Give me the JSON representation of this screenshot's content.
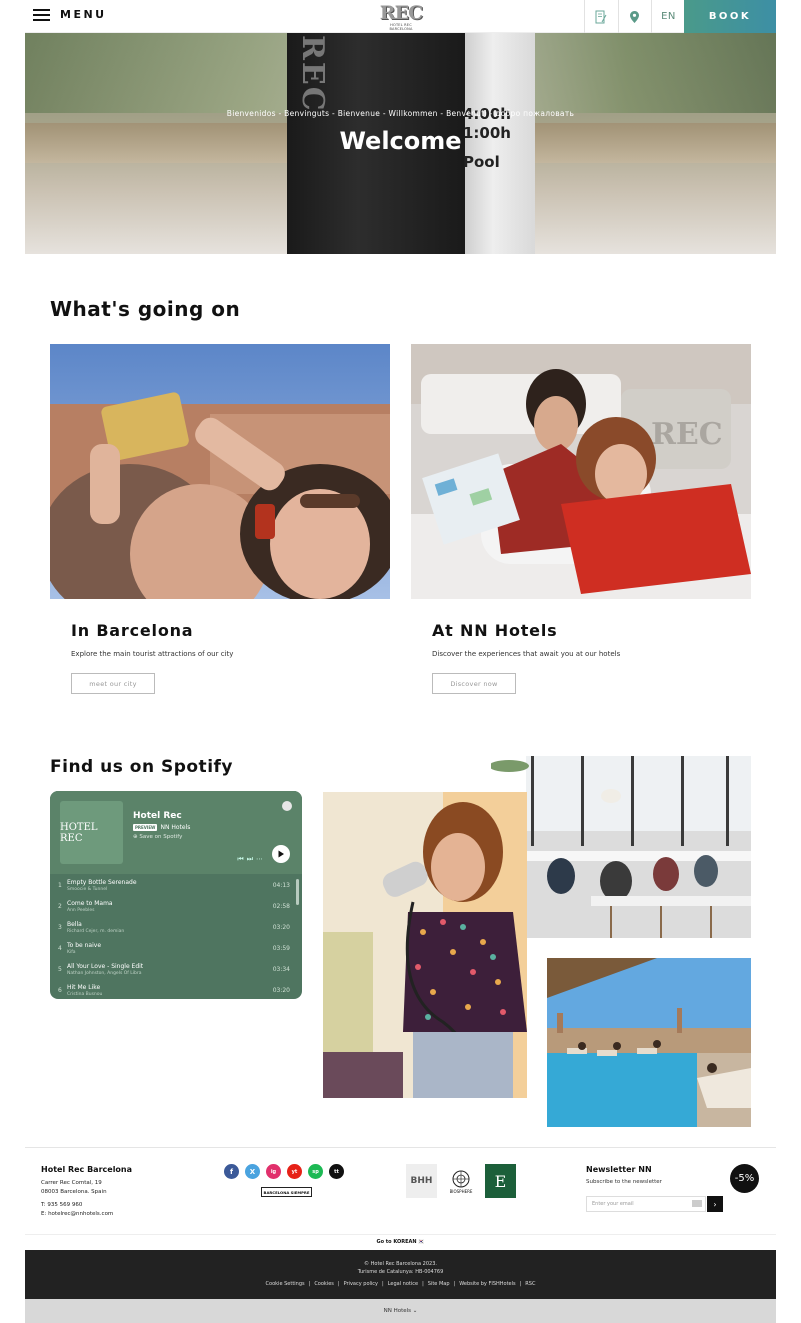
{
  "header": {
    "menu_label": "MENU",
    "logo_text": "REC",
    "logo_sub": "HOTEL REC BARCELONA",
    "language": "EN",
    "book_label": "BOOK"
  },
  "hero": {
    "greeting": "Bienvenidos - Benvinguts - Bienvenue - Willkommen - Benvenuti - добро пожаловать",
    "title": "Welcome",
    "tube_text": "REC",
    "sign_lines": [
      "4:00h",
      "1:00h",
      "Pool"
    ]
  },
  "whats_going_on": {
    "title": "What's going on",
    "cards": [
      {
        "title": "In Barcelona",
        "description": "Explore the main tourist attractions of our city",
        "button": "meet our city"
      },
      {
        "title": "At NN Hotels",
        "description": "Discover the experiences that await you at our hotels",
        "button": "Discover now"
      }
    ]
  },
  "spotify": {
    "title": "Find us on Spotify",
    "cover_text": "HOTEL REC",
    "playlist_name": "Hotel Rec",
    "preview_badge": "PREVIEW",
    "owner": "NN Hotels",
    "save_label": "Save on Spotify",
    "tracks": [
      {
        "num": "1",
        "title": "Empty Bottle Serenade",
        "artist": "Smoocie & Tunnel",
        "duration": "04:13"
      },
      {
        "num": "2",
        "title": "Come to Mama",
        "artist": "Ann Peebles",
        "duration": "02:58"
      },
      {
        "num": "3",
        "title": "Bella",
        "artist": "Richard Cejer, m. demian",
        "duration": "03:20"
      },
      {
        "num": "4",
        "title": "To be naive",
        "artist": "Kifa",
        "duration": "03:59"
      },
      {
        "num": "5",
        "title": "All Your Love - Single Edit",
        "artist": "Nathan Johnston, Angels Of Libra",
        "duration": "03:34"
      },
      {
        "num": "6",
        "title": "Hit Me Like",
        "artist": "Cristina Busnou",
        "duration": "03:20"
      }
    ]
  },
  "footer": {
    "hotel_name": "Hotel Rec Barcelona",
    "address_1": "Carrer Rec Comtal, 19",
    "address_2": "08003 Barcelona. Spain",
    "phone": "T: 935 569 960",
    "email": "E: hotelrec@nnhotels.com",
    "social": [
      "f",
      "X",
      "ig",
      "yt",
      "sp",
      "tt"
    ],
    "barcelona_badge": "BARCELONA SIEMPRE",
    "certs": [
      "BHH",
      "BIOSPHERE",
      "E"
    ],
    "newsletter_title": "Newsletter NN",
    "newsletter_sub": "Subscribe to the newsletter",
    "email_placeholder": "Enter your email",
    "discount": "-5%",
    "go_korean": "Go to KOREAN",
    "copyright": "© Hotel Rec Barcelona 2023.",
    "license": "Turisme de Catalunya: HB-004769",
    "links": [
      "Cookie Settings",
      "Cookies",
      "Privacy policy",
      "Legal notice",
      "Site Map",
      "Website by FISHHotels",
      "RSC"
    ],
    "nn_hotels": "NN Hotels"
  },
  "colors": {
    "accent": "#4a9a8a",
    "spotify_bg": "#4f7560",
    "footer_dark": "#222222"
  }
}
